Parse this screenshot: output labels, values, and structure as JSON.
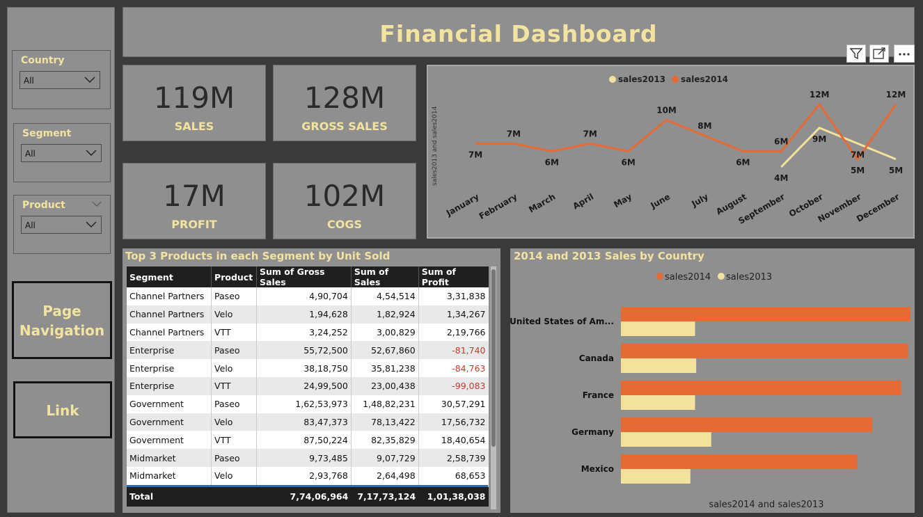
{
  "header": {
    "title": "Financial Dashboard"
  },
  "sidebar": {
    "slicers": [
      {
        "label": "Country",
        "value": "All"
      },
      {
        "label": "Segment",
        "value": "All"
      },
      {
        "label": "Product",
        "value": "All"
      }
    ],
    "nav_button": {
      "line1": "Page",
      "line2": "Navigation"
    },
    "link_button": "Link"
  },
  "kpis": [
    {
      "value": "119M",
      "label": "SALES"
    },
    {
      "value": "128M",
      "label": "GROSS SALES"
    },
    {
      "value": "17M",
      "label": "PROFIT"
    },
    {
      "value": "102M",
      "label": "COGS"
    }
  ],
  "visual_header_icons": [
    "filter-icon",
    "focus-mode-icon",
    "more-options-icon"
  ],
  "line_chart": {
    "ylabel": "sales2013 and sales2014",
    "legend": [
      "sales2013",
      "sales2014"
    ],
    "colors": {
      "sales2013": "#f2e29b",
      "sales2014": "#e66a34"
    },
    "chart_data": {
      "type": "line",
      "categories": [
        "January",
        "February",
        "March",
        "April",
        "May",
        "June",
        "July",
        "August",
        "September",
        "October",
        "November",
        "December"
      ],
      "series": [
        {
          "name": "sales2014",
          "values": [
            7,
            7,
            6,
            7,
            6,
            10,
            8,
            6,
            6,
            12,
            5,
            12
          ],
          "labels": [
            "7M",
            "7M",
            "6M",
            "7M",
            "6M",
            "10M",
            "8M",
            "6M",
            "6M",
            "12M",
            "5M",
            "12M"
          ]
        },
        {
          "name": "sales2013",
          "values": [
            null,
            null,
            null,
            null,
            null,
            null,
            null,
            null,
            4,
            9,
            7,
            5
          ],
          "labels": [
            "",
            "",
            "",
            "",
            "",
            "",
            "",
            "",
            "4M",
            "9M",
            "7M",
            "5M"
          ]
        }
      ]
    }
  },
  "table": {
    "title": "Top 3 Products in each Segment by Unit Sold",
    "columns": [
      "Segment",
      "Product",
      "Sum of Gross Sales",
      "Sum of Sales",
      "Sum of Profit"
    ],
    "rows": [
      [
        "Channel Partners",
        "Paseo",
        "4,90,704",
        "4,54,514",
        "3,31,838"
      ],
      [
        "Channel Partners",
        "Velo",
        "1,94,628",
        "1,82,924",
        "1,34,267"
      ],
      [
        "Channel Partners",
        "VTT",
        "3,24,252",
        "3,00,829",
        "2,19,766"
      ],
      [
        "Enterprise",
        "Paseo",
        "55,72,500",
        "52,67,860",
        "-81,740"
      ],
      [
        "Enterprise",
        "Velo",
        "38,18,750",
        "35,81,238",
        "-84,763"
      ],
      [
        "Enterprise",
        "VTT",
        "24,99,500",
        "23,00,438",
        "-99,083"
      ],
      [
        "Government",
        "Paseo",
        "1,62,53,973",
        "1,48,82,231",
        "30,57,291"
      ],
      [
        "Government",
        "Velo",
        "83,47,373",
        "78,13,422",
        "17,56,732"
      ],
      [
        "Government",
        "VTT",
        "87,50,224",
        "82,35,829",
        "18,40,654"
      ],
      [
        "Midmarket",
        "Paseo",
        "9,73,485",
        "9,07,729",
        "2,58,739"
      ],
      [
        "Midmarket",
        "Velo",
        "2,93,768",
        "2,64,498",
        "68,653"
      ]
    ],
    "total": [
      "Total",
      "",
      "7,74,06,964",
      "7,17,73,124",
      "1,01,38,038"
    ]
  },
  "bar_chart": {
    "title": "2014 and 2013 Sales by Country",
    "legend": [
      "sales2014",
      "sales2013"
    ],
    "xlabel": "sales2014 and sales2013",
    "colors": {
      "sales2014": "#e66a34",
      "sales2013": "#f2e29b"
    },
    "chart_data": {
      "type": "bar",
      "orientation": "horizontal",
      "categories": [
        "United States of Am...",
        "Canada",
        "France",
        "Germany",
        "Mexico"
      ],
      "series": [
        {
          "name": "sales2014",
          "values": [
            25.0,
            24.8,
            24.2,
            21.7,
            20.4
          ]
        },
        {
          "name": "sales2013",
          "values": [
            6.4,
            6.5,
            6.4,
            7.8,
            6.0
          ]
        }
      ],
      "xlim": [
        0,
        25
      ]
    }
  }
}
